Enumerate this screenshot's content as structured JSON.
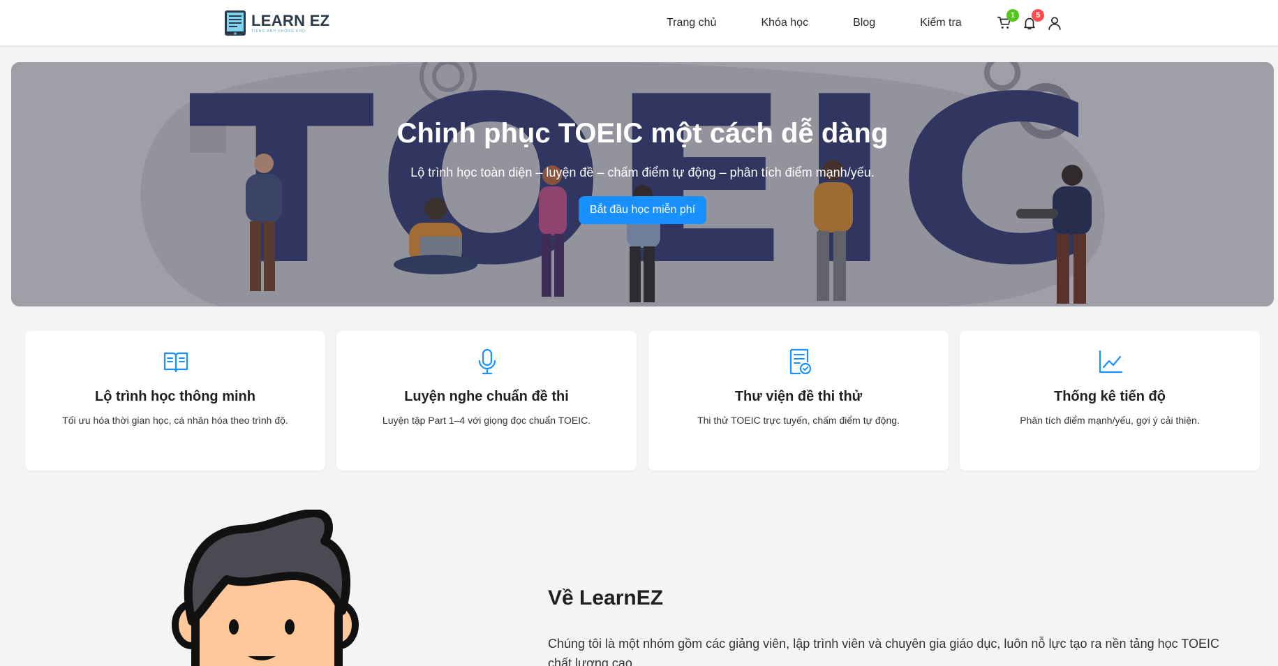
{
  "header": {
    "logo_text": "LEARN EZ",
    "logo_tagline": "TIẾNG ANH KHÔNG KHÓ",
    "nav": [
      "Trang chủ",
      "Khóa học",
      "Blog",
      "Kiểm tra"
    ],
    "cart_count": "1",
    "notification_count": "5"
  },
  "hero": {
    "title": "Chinh phục TOEIC một cách dễ dàng",
    "subtitle": "Lộ trình học toàn diện – luyện đề – chấm điểm tự động – phân tích điểm mạnh/yếu.",
    "cta": "Bắt đầu học miễn phí",
    "background_text": "TOEIC"
  },
  "features": [
    {
      "icon": "book-open-icon",
      "title": "Lộ trình học thông minh",
      "desc": "Tối ưu hóa thời gian học, cá nhân hóa theo trình độ."
    },
    {
      "icon": "microphone-icon",
      "title": "Luyện nghe chuẩn đề thi",
      "desc": "Luyện tập Part 1–4 với giọng đọc chuẩn TOEIC."
    },
    {
      "icon": "document-check-icon",
      "title": "Thư viện đề thi thử",
      "desc": "Thi thử TOEIC trực tuyến, chấm điểm tự động."
    },
    {
      "icon": "line-chart-icon",
      "title": "Thống kê tiến độ",
      "desc": "Phân tích điểm mạnh/yếu, gợi ý cải thiện."
    }
  ],
  "about": {
    "title": "Về LearnEZ",
    "text": "Chúng tôi là một nhóm gồm các giảng viên, lập trình viên và chuyên gia giáo dục, luôn nỗ lực tạo ra nền tảng học TOEIC chất lượng cao."
  },
  "colors": {
    "primary": "#1890ff",
    "cart_badge": "#52c41a",
    "notification_badge": "#ff4d4f",
    "hero_letters": "#2b3270"
  }
}
